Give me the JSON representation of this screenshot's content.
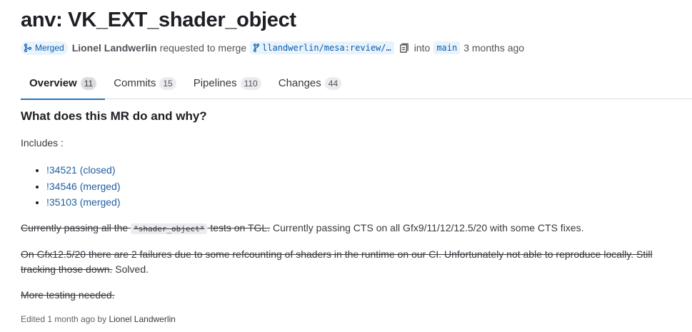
{
  "title": "anv: VK_EXT_shader_object",
  "status": {
    "label": "Merged",
    "color": "#0b5cad",
    "icon": "merge-icon"
  },
  "meta": {
    "author": "Lionel Landwerlin",
    "action": "requested to merge",
    "source_branch": "llandwerlin/mesa:review/…",
    "copy_icon": "copy-icon",
    "into": "into",
    "target_branch": "main",
    "time": "3 months ago"
  },
  "tabs": [
    {
      "label": "Overview",
      "count": "11",
      "active": true
    },
    {
      "label": "Commits",
      "count": "15",
      "active": false
    },
    {
      "label": "Pipelines",
      "count": "110",
      "active": false
    },
    {
      "label": "Changes",
      "count": "44",
      "active": false
    }
  ],
  "description": {
    "heading": "What does this MR do and why?",
    "includes_label": "Includes :",
    "items": [
      "!34521 (closed)",
      "!34546 (merged)",
      "!35103 (merged)"
    ],
    "p1_strike_a": "Currently passing all the",
    "p1_code": "*shader_object*",
    "p1_strike_b": "tests on TGL.",
    "p1_rest": " Currently passing CTS on all Gfx9/11/12/12.5/20 with some CTS fixes.",
    "p2_strike": "On Gfx12.5/20 there are 2 failures due to some refcounting of shaders in the runtime on our CI. Unfortunately not able to reproduce locally. Still tracking those down.",
    "p2_rest": " Solved.",
    "p3_strike": "More testing needed."
  },
  "edited": {
    "text": "Edited 1 month ago by",
    "by": "Lionel Landwerlin"
  }
}
